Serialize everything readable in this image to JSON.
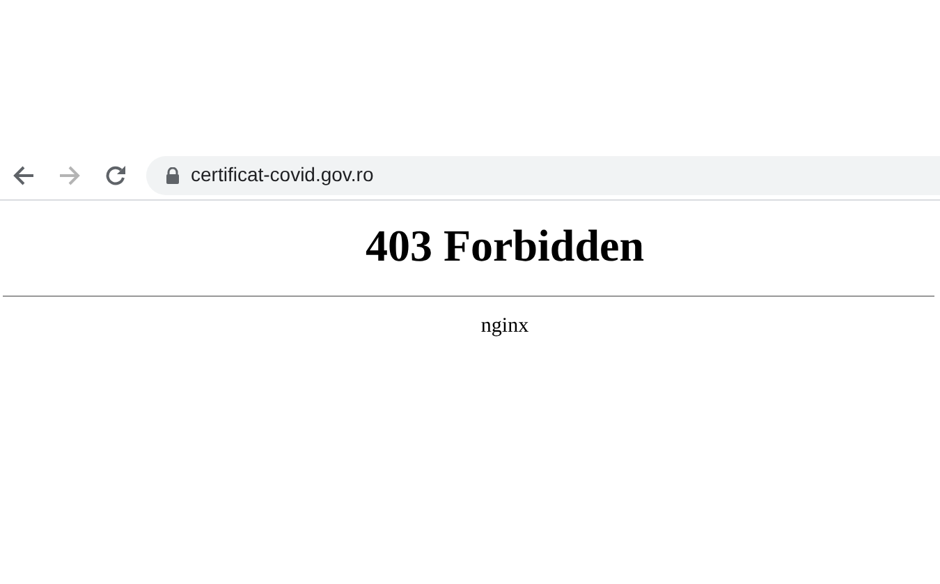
{
  "toolbar": {
    "nav_buttons": [
      {
        "kind": "back",
        "disabled": false
      },
      {
        "kind": "forward",
        "disabled": true
      },
      {
        "kind": "reload",
        "disabled": false
      }
    ],
    "address": "certificat-covid.gov.ro"
  },
  "page": {
    "heading": "403 Forbidden",
    "server": "nginx"
  }
}
